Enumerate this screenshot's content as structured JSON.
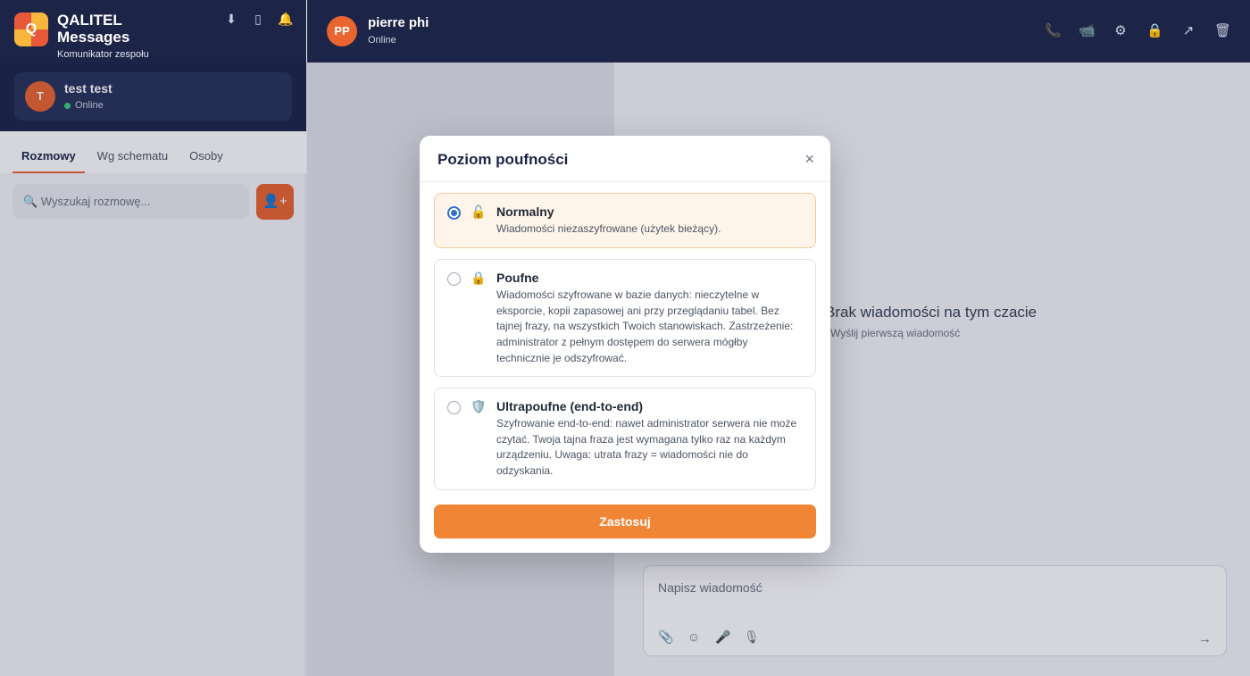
{
  "app": {
    "title": "QALITEL Messages",
    "subtitle": "Komunikator zespołu",
    "logo_letter": "Q",
    "header_icons": [
      "download-icon",
      "phone-device-icon",
      "bell-icon"
    ]
  },
  "current_user": {
    "initial": "T",
    "name": "test test",
    "status": "Online"
  },
  "sidebar": {
    "tabs": [
      {
        "label": "Rozmowy",
        "active": true
      },
      {
        "label": "Wg schematu",
        "active": false
      },
      {
        "label": "Osoby",
        "active": false
      }
    ],
    "search_placeholder": "🔍 Wyszukaj rozmowę...",
    "add_label": "👤+"
  },
  "chat": {
    "peer_initials": "PP",
    "peer_name": "pierre phi",
    "peer_status": "Online",
    "actions": [
      "phone-icon",
      "video-icon",
      "gear-icon",
      "lock-icon",
      "share-icon",
      "trash-icon"
    ],
    "empty_title": "Brak wiadomości na tym czacie",
    "empty_subtitle": "Wyślij pierwszą wiadomość",
    "composer_placeholder": "Napisz wiadomość",
    "composer_icons": [
      "paperclip-icon",
      "emoji-icon",
      "microphone-icon",
      "voice-icon"
    ],
    "send_icon": "→"
  },
  "modal": {
    "title": "Poziom poufności",
    "close": "×",
    "options": [
      {
        "icon": "🔓",
        "title": "Normalny",
        "description": "Wiadomości niezaszyfrowane (użytek bieżący).",
        "selected": true
      },
      {
        "icon": "🔒",
        "title": "Poufne",
        "description": "Wiadomości szyfrowane w bazie danych: nieczytelne w eksporcie, kopii zapasowej ani przy przeglądaniu tabel. Bez tajnej frazy, na wszystkich Twoich stanowiskach. Zastrzeżenie: administrator z pełnym dostępem do serwera mógłby technicznie je odszyfrować.",
        "selected": false
      },
      {
        "icon": "🛡️",
        "title": "Ultrapoufne (end-to-end)",
        "description": "Szyfrowanie end-to-end: nawet administrator serwera nie może czytać. Twoja tajna fraza jest wymagana tylko raz na każdym urządzeniu. Uwaga: utrata frazy = wiadomości nie do odzyskania.",
        "selected": false
      }
    ],
    "apply_label": "Zastosuj"
  }
}
